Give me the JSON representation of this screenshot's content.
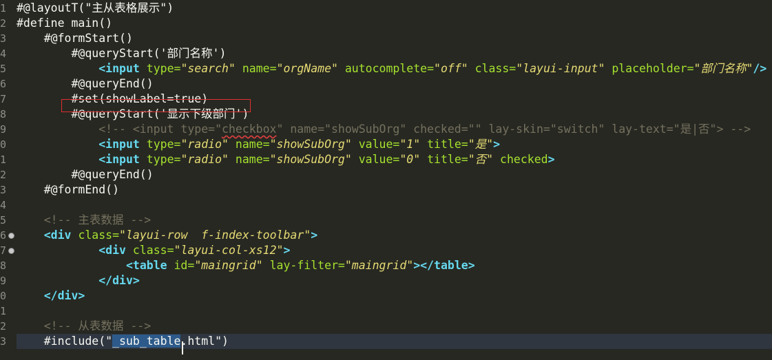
{
  "gutter": [
    "1",
    "2",
    "3",
    "4",
    "5",
    "6",
    "7",
    "8",
    "9",
    "0",
    "1",
    "2",
    "3",
    "4",
    "5",
    "6",
    "7",
    "8",
    "9",
    "0",
    "1",
    "2",
    "3"
  ],
  "lines": [
    [
      {
        "c": "txt",
        "t": "#@layoutT(\"主从表格展示\")"
      }
    ],
    [
      {
        "c": "txt",
        "t": "#define main()"
      }
    ],
    [
      {
        "c": "txt",
        "t": "    #@formStart()"
      }
    ],
    [
      {
        "c": "txt",
        "t": "        #@queryStart('部门名称')"
      }
    ],
    [
      {
        "c": "txt",
        "t": "            "
      },
      {
        "c": "tag",
        "t": "<input"
      },
      {
        "c": "txt",
        "t": " "
      },
      {
        "c": "attr",
        "t": "type="
      },
      {
        "c": "str",
        "t": "\"search\""
      },
      {
        "c": "txt",
        "t": " "
      },
      {
        "c": "attr",
        "t": "name="
      },
      {
        "c": "str",
        "t": "\"orgName\""
      },
      {
        "c": "txt",
        "t": " "
      },
      {
        "c": "attr",
        "t": "autocomplete="
      },
      {
        "c": "str",
        "t": "\"off\""
      },
      {
        "c": "txt",
        "t": " "
      },
      {
        "c": "attr",
        "t": "class="
      },
      {
        "c": "str",
        "t": "\"layui-input\""
      },
      {
        "c": "txt",
        "t": " "
      },
      {
        "c": "attr",
        "t": "placeholder="
      },
      {
        "c": "str",
        "t": "\"部门名称\""
      },
      {
        "c": "tag",
        "t": "/>"
      }
    ],
    [
      {
        "c": "txt",
        "t": "        #@queryEnd()"
      }
    ],
    [
      {
        "c": "txt",
        "t": "        #set(showLabel=true)"
      }
    ],
    [
      {
        "c": "txt",
        "t": "        #@queryStart('显示下级部门')"
      }
    ],
    [
      {
        "c": "cmt",
        "t": "            <!-- <input type=\""
      },
      {
        "c": "cmt squig",
        "t": "checkbox"
      },
      {
        "c": "cmt",
        "t": "\" name=\"showSubOrg\" checked=\"\" lay-skin=\"switch\" lay-text=\"是|否\"> -->"
      }
    ],
    [
      {
        "c": "txt",
        "t": "            "
      },
      {
        "c": "tag",
        "t": "<input"
      },
      {
        "c": "txt",
        "t": " "
      },
      {
        "c": "attr",
        "t": "type="
      },
      {
        "c": "str",
        "t": "\"radio\""
      },
      {
        "c": "txt",
        "t": " "
      },
      {
        "c": "attr",
        "t": "name="
      },
      {
        "c": "str",
        "t": "\"showSubOrg\""
      },
      {
        "c": "txt",
        "t": " "
      },
      {
        "c": "attr",
        "t": "value="
      },
      {
        "c": "str",
        "t": "\"1\""
      },
      {
        "c": "txt",
        "t": " "
      },
      {
        "c": "attr",
        "t": "title="
      },
      {
        "c": "str",
        "t": "\"是\""
      },
      {
        "c": "tag",
        "t": ">"
      }
    ],
    [
      {
        "c": "txt",
        "t": "            "
      },
      {
        "c": "tag",
        "t": "<input"
      },
      {
        "c": "txt",
        "t": " "
      },
      {
        "c": "attr",
        "t": "type="
      },
      {
        "c": "str",
        "t": "\"radio\""
      },
      {
        "c": "txt",
        "t": " "
      },
      {
        "c": "attr",
        "t": "name="
      },
      {
        "c": "str",
        "t": "\"showSubOrg\""
      },
      {
        "c": "txt",
        "t": " "
      },
      {
        "c": "attr",
        "t": "value="
      },
      {
        "c": "str",
        "t": "\"0\""
      },
      {
        "c": "txt",
        "t": " "
      },
      {
        "c": "attr",
        "t": "title="
      },
      {
        "c": "str",
        "t": "\"否\""
      },
      {
        "c": "txt",
        "t": " "
      },
      {
        "c": "attr",
        "t": "checked"
      },
      {
        "c": "tag",
        "t": ">"
      }
    ],
    [
      {
        "c": "txt",
        "t": "        #@queryEnd()"
      }
    ],
    [
      {
        "c": "txt",
        "t": "    #@formEnd()"
      }
    ],
    [
      {
        "c": "txt",
        "t": ""
      }
    ],
    [
      {
        "c": "cmt",
        "t": "    <!-- 主表数据 -->"
      }
    ],
    [
      {
        "c": "txt",
        "t": "    "
      },
      {
        "c": "tag",
        "t": "<div"
      },
      {
        "c": "txt",
        "t": " "
      },
      {
        "c": "attr",
        "t": "class="
      },
      {
        "c": "str",
        "t": "\"layui-row  f-index-toolbar\""
      },
      {
        "c": "tag",
        "t": ">"
      }
    ],
    [
      {
        "c": "txt",
        "t": "            "
      },
      {
        "c": "tag",
        "t": "<div"
      },
      {
        "c": "txt",
        "t": " "
      },
      {
        "c": "attr",
        "t": "class="
      },
      {
        "c": "str",
        "t": "\"layui-col-xs12\""
      },
      {
        "c": "tag",
        "t": ">"
      }
    ],
    [
      {
        "c": "txt",
        "t": "                "
      },
      {
        "c": "tag",
        "t": "<table"
      },
      {
        "c": "txt",
        "t": " "
      },
      {
        "c": "attr",
        "t": "id="
      },
      {
        "c": "str",
        "t": "\"maingrid\""
      },
      {
        "c": "txt",
        "t": " "
      },
      {
        "c": "attr",
        "t": "lay-filter="
      },
      {
        "c": "str",
        "t": "\"maingrid\""
      },
      {
        "c": "tag",
        "t": "></table>"
      }
    ],
    [
      {
        "c": "txt",
        "t": "            "
      },
      {
        "c": "tag",
        "t": "</div>"
      }
    ],
    [
      {
        "c": "txt",
        "t": "    "
      },
      {
        "c": "tag",
        "t": "</div>"
      }
    ],
    [
      {
        "c": "txt",
        "t": ""
      }
    ],
    [
      {
        "c": "cmt",
        "t": "    <!-- 从表数据 -->"
      }
    ],
    [
      {
        "c": "txt",
        "t": "    #include(\""
      },
      {
        "c": "sel",
        "t": "_sub_table"
      },
      {
        "c": "txt",
        "t": ".html\")"
      }
    ]
  ]
}
